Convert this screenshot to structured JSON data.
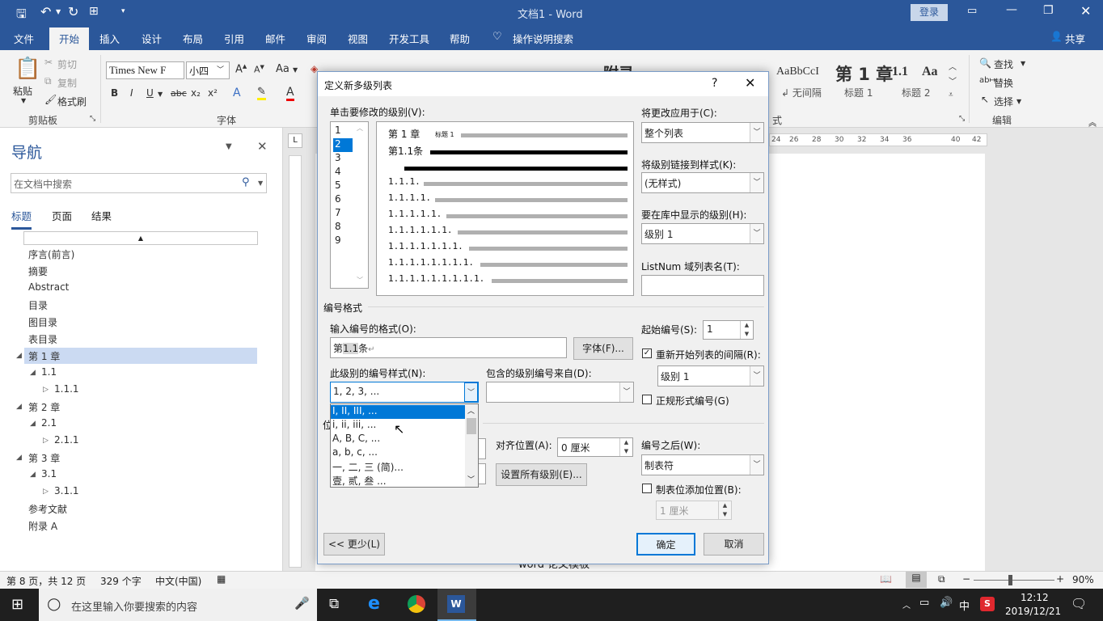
{
  "window": {
    "title": "文档1  -  Word",
    "login": "登录"
  },
  "tabs": [
    "文件",
    "开始",
    "插入",
    "设计",
    "布局",
    "引用",
    "邮件",
    "审阅",
    "视图",
    "开发工具",
    "帮助",
    "操作说明搜索"
  ],
  "share": "共享",
  "ribbon": {
    "clipboard": {
      "paste": "粘贴",
      "cut": "剪切",
      "copy": "复制",
      "format_painter": "格式刷",
      "label": "剪贴板"
    },
    "font": {
      "font_name": "Times New F",
      "font_size": "小四",
      "label": "字体",
      "aa": "Aa",
      "bold": "B",
      "italic": "I",
      "underline": "U",
      "strike": "abc",
      "sub": "x₂",
      "sup": "x²"
    },
    "styles": {
      "preview1": "附录",
      "preview2": "AaBbCcI",
      "preview3": "第 1 章",
      "preview4": "1.1",
      "preview5": "Aa",
      "name_nospace": "↲ 无间隔",
      "name_h1": "标题 1",
      "name_h2": "标题 2",
      "label": "式"
    },
    "editing": {
      "find": "查找",
      "replace": "替换",
      "select": "选择",
      "label": "编辑"
    }
  },
  "ruler": {
    "ticks": [
      "24",
      "26",
      "28",
      "30",
      "32",
      "34",
      "36",
      "40",
      "42"
    ]
  },
  "nav": {
    "title": "导航",
    "search_placeholder": "在文档中搜索",
    "tabs": [
      "标题",
      "页面",
      "结果"
    ],
    "items": [
      {
        "label": "序言(前言)"
      },
      {
        "label": "摘要"
      },
      {
        "label": "Abstract"
      },
      {
        "label": "目录"
      },
      {
        "label": "图目录"
      },
      {
        "label": "表目录"
      },
      {
        "label": "第 1 章"
      },
      {
        "label": "1.1"
      },
      {
        "label": "1.1.1"
      },
      {
        "label": "第 2 章"
      },
      {
        "label": "2.1"
      },
      {
        "label": "2.1.1"
      },
      {
        "label": "第 3 章"
      },
      {
        "label": "3.1"
      },
      {
        "label": "3.1.1"
      },
      {
        "label": "参考文献"
      },
      {
        "label": "附录 A"
      }
    ]
  },
  "doc": {
    "footer_text": "word 论文模板"
  },
  "dialog": {
    "title": "定义新多级列表",
    "help": "?",
    "level_label": "单击要修改的级别(V):",
    "levels": [
      "1",
      "2",
      "3",
      "4",
      "5",
      "6",
      "7",
      "8",
      "9"
    ],
    "preview": {
      "row1": "第 1 章",
      "row1_style": "标题 1",
      "row2": "第1.1条",
      "rows": [
        "1.1.1.",
        "1.1.1.1.",
        "1.1.1.1.1.",
        "1.1.1.1.1.1.",
        "1.1.1.1.1.1.1.",
        "1.1.1.1.1.1.1.1.",
        "1.1.1.1.1.1.1.1.1."
      ]
    },
    "apply_label": "将更改应用于(C):",
    "apply_value": "整个列表",
    "link_label": "将级别链接到样式(K):",
    "link_value": "(无样式)",
    "gallery_label": "要在库中显示的级别(H):",
    "gallery_value": "级别 1",
    "listnum_label": "ListNum 域列表名(T):",
    "listnum_value": "",
    "number_format_section": "编号格式",
    "enter_format_label": "输入编号的格式(O):",
    "format_value_prefix": "第",
    "format_value_num": "1.1",
    "format_value_suffix": "条",
    "font_button": "字体(F)...",
    "start_label": "起始编号(S):",
    "start_value": "1",
    "restart_label": "重新开始列表的间隔(R):",
    "restart_value": "级别 1",
    "legal_label": "正规形式编号(G)",
    "style_label": "此级别的编号样式(N):",
    "style_value": "1, 2, 3, ...",
    "include_label": "包含的级别编号来自(D):",
    "include_value": "",
    "style_options": [
      "I, II, III, ...",
      "i, ii, iii, ...",
      "A, B, C, ...",
      "a, b, c, ...",
      "一, 二, 三 (简)...",
      "壹, 贰, 叁 ..."
    ],
    "position_label": "位",
    "align_label": "对齐位置(A):",
    "align_value": "0 厘米",
    "set_all_button": "设置所有级别(E)...",
    "after_label": "编号之后(W):",
    "after_value": "制表符",
    "tab_add_label": "制表位添加位置(B):",
    "tab_add_value": "1 厘米",
    "less_button": "<< 更少(L)",
    "ok_button": "确定",
    "cancel_button": "取消"
  },
  "status": {
    "page": "第 8 页，共 12 页",
    "words": "329 个字",
    "lang": "中文(中国)",
    "zoom": "90%",
    "zoom_level": 0.45
  },
  "taskbar": {
    "search_placeholder": "在这里输入你要搜索的内容",
    "ime": "中",
    "time": "12:12",
    "date": "2019/12/21"
  }
}
